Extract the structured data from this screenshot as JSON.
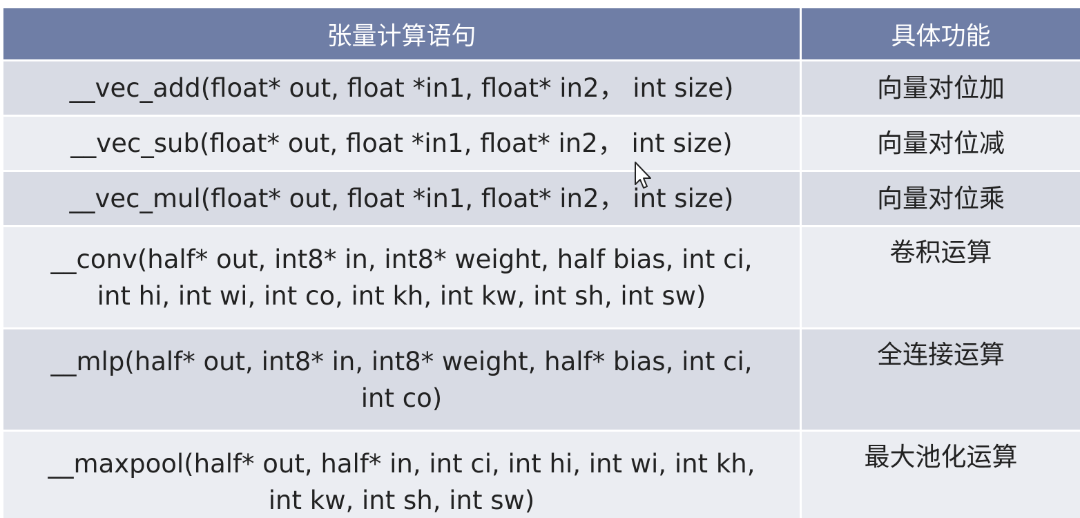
{
  "table": {
    "headers": [
      "张量计算语句",
      "具体功能"
    ],
    "rows": [
      {
        "statement": "__vec_add(float* out, float *in1, float* in2，  int size)",
        "function": "向量对位加"
      },
      {
        "statement": "__vec_sub(float* out, float *in1, float* in2，  int size)",
        "function": "向量对位减"
      },
      {
        "statement": "__vec_mul(float* out, float *in1, float* in2，  int size)",
        "function": "向量对位乘"
      },
      {
        "statement_lines": [
          "__conv(half* out, int8* in, int8* weight, half bias, int ci,",
          "int hi, int wi, int co, int kh, int kw, int sh, int sw)"
        ],
        "function": "卷积运算"
      },
      {
        "statement_lines": [
          "__mlp(half* out, int8* in, int8* weight, half* bias, int ci,",
          "int co)"
        ],
        "function": "全连接运算"
      },
      {
        "statement_lines": [
          "__maxpool(half* out, half* in, int ci, int hi, int wi, int kh,",
          "int kw, int sh, int sw)"
        ],
        "function": "最大池化运算"
      }
    ]
  },
  "colors": {
    "header_bg": "#6f7ea6",
    "row_dark": "#d8dbe4",
    "row_light": "#ebedf2"
  }
}
